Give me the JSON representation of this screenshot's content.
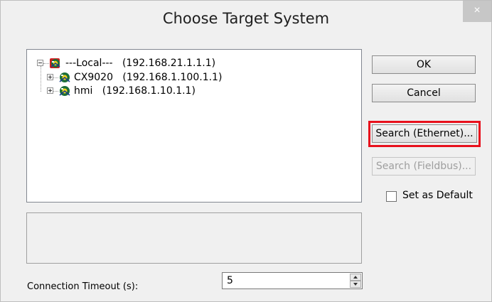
{
  "window": {
    "title": "Choose Target System",
    "close_glyph": "×"
  },
  "tree": {
    "nodes": [
      {
        "name": "---Local---",
        "address": "(192.168.21.1.1.1)",
        "expanded": true,
        "icon": "target-system-icon"
      },
      {
        "name": "CX9020",
        "address": "(192.168.1.100.1.1)",
        "expanded": false,
        "icon": "target-system-icon"
      },
      {
        "name": "hmi",
        "address": "(192.168.1.10.1.1)",
        "expanded": false,
        "icon": "target-system-icon"
      }
    ]
  },
  "timeout": {
    "label": "Connection Timeout (s):",
    "value": "5"
  },
  "buttons": {
    "ok": "OK",
    "cancel": "Cancel",
    "search_ethernet": "Search (Ethernet)...",
    "search_fieldbus": "Search (Fieldbus)..."
  },
  "set_default": {
    "label": "Set as Default",
    "checked": false
  },
  "colors": {
    "highlight": "#e8101c",
    "window_bg": "#f0f0f0"
  }
}
